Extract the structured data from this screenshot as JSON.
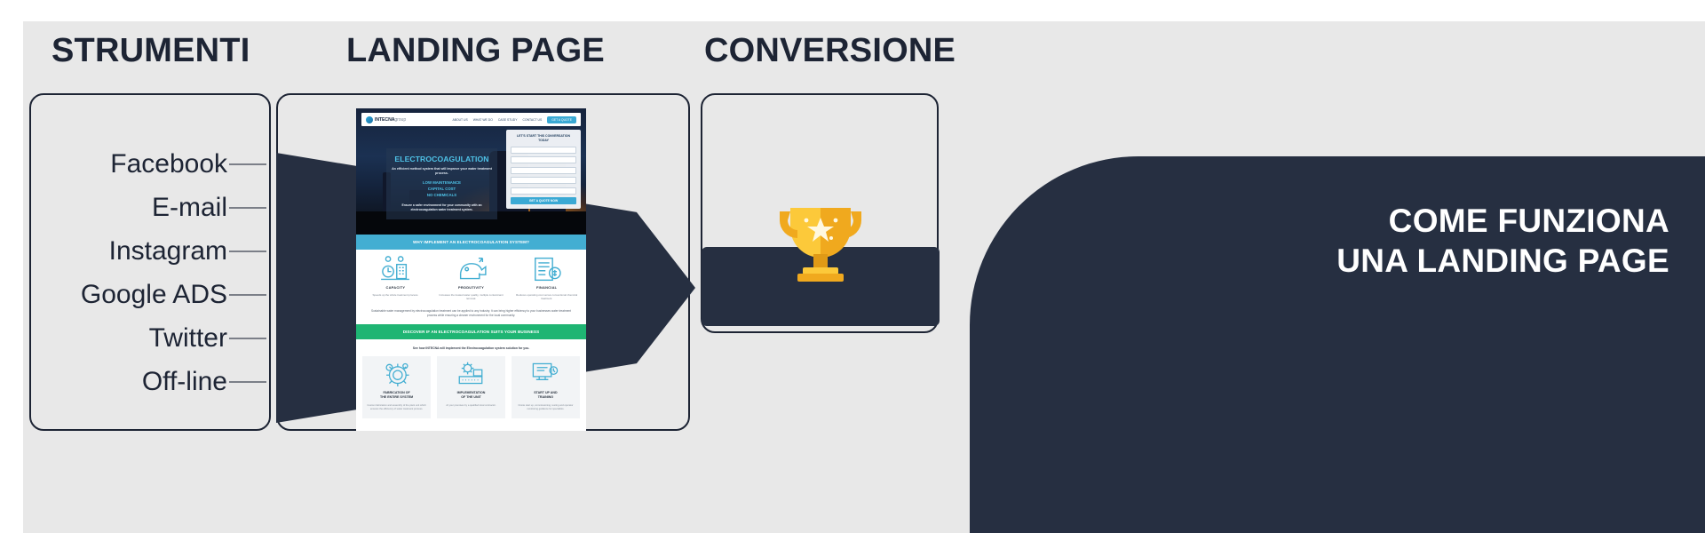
{
  "columns": {
    "strumenti": "STRUMENTI",
    "landing": "LANDING PAGE",
    "conversione": "CONVERSIONE"
  },
  "channels": [
    {
      "label": "Facebook"
    },
    {
      "label": "E-mail"
    },
    {
      "label": "Instagram"
    },
    {
      "label": "Google ADS"
    },
    {
      "label": "Twitter"
    },
    {
      "label": "Off-line"
    }
  ],
  "banner": {
    "text": "COME FUNZIONA\nUNA LANDING PAGE"
  },
  "conversion": {
    "icon": "trophy-icon"
  },
  "mockup": {
    "nav": {
      "logo_main": "INTECNA",
      "logo_sub": "group",
      "links": [
        "ABOUT US",
        "WHAT WE DO",
        "CASE STUDY",
        "CONTACT US"
      ],
      "cta": "GET A QUOTE"
    },
    "hero": {
      "heading": "ELECTROCOAGULATION",
      "subheading": "An efficient method system that will improve your water treatment process.",
      "bullets": "LOW MAINTENANCE\nCAPITAL COST\nNO CHEMICALS",
      "tagline": "Ensure a safer environment for your community with an electrocoagulation water treatment system."
    },
    "form": {
      "title": "LET'S START THIS CONVERSATION\nTODAY",
      "fields": [
        "",
        "",
        "",
        "",
        ""
      ],
      "button": "GET A QUOTE NOW"
    },
    "why_band": "WHY IMPLEMENT AN ELECTROCOAGULATION SYSTEM?",
    "features": [
      {
        "icon": "capacity-icon",
        "name": "CAPACITY",
        "desc": "Speeds up the whole treatment process."
      },
      {
        "icon": "productivity-icon",
        "name": "PRODUTIVITY",
        "desc": "Increases the treated water quality, multiple contaminant removal."
      },
      {
        "icon": "financial-icon",
        "name": "FINANCIAL",
        "desc": "Reduces operating cost versus conventional chemical treatment."
      }
    ],
    "paragraph": "Sustainable water management by electrocoagulation treatment can be applied to any industry. It can bring higher efficiency to your businesses water treatment process while ensuring a cleaner environment for the local community.",
    "discover_band": "DISCOVER IF AN ELECTROCOAGULATION SUITS YOUR BUSINESS",
    "cards_lead": "See how INTECNA will implement the Electrocoagulation system solution for you.",
    "cards": [
      {
        "icon": "gears-icon",
        "name": "FABRICATION OF\nTHE ENTIRE SYSTEM",
        "desc": "Custom fabrication and assembly of the plant unit which ensures the efficiency of water treatment process."
      },
      {
        "icon": "install-icon",
        "name": "IMPLEMENTATION\nOF THE UNIT",
        "desc": "At your premises by a qualified local contractor."
      },
      {
        "icon": "training-icon",
        "name": "START UP AND\nTRAINING",
        "desc": "Onsite start up, commissioning, testing and operator monitoring guidance for specialists."
      }
    ]
  },
  "colors": {
    "navy": "#262f41",
    "page_bg": "#e8e8e8",
    "accent_blue": "#43aed2",
    "accent_green": "#1fb573",
    "gold": "#f5b921"
  }
}
